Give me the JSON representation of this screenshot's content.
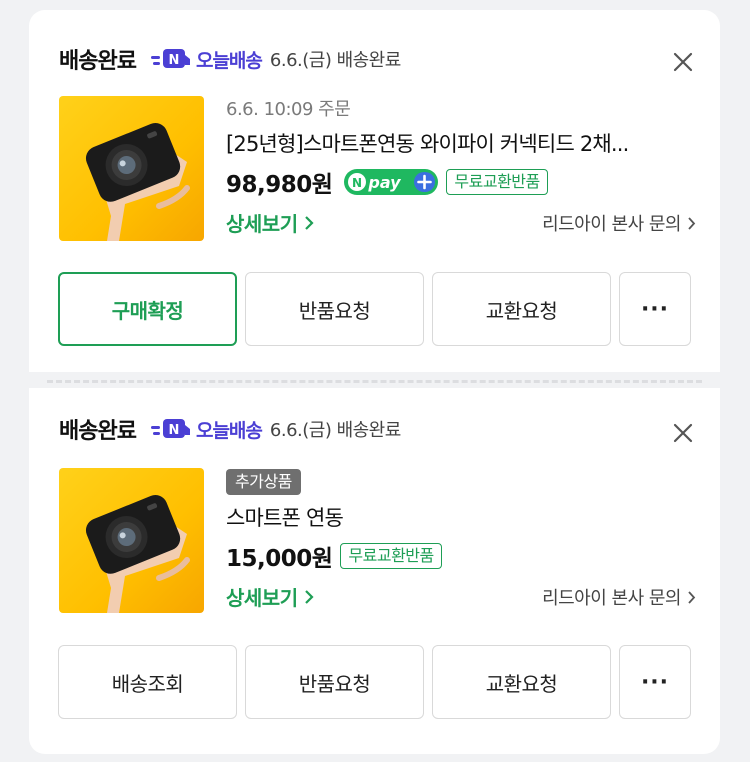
{
  "orders": [
    {
      "status_title": "배송완료",
      "today_label": "오늘배송",
      "date_status": "6.6.(금) 배송완료",
      "order_time": "6.6. 10:09 주문",
      "product_name": "[25년형]스마트폰연동 와이파이 커넥티드 2채...",
      "price": "98,980원",
      "npay_label": "pay",
      "free_tag": "무료교환반품",
      "detail_link": "상세보기",
      "inquiry_link": "리드아이 본사 문의",
      "buttons": [
        "구매확정",
        "반품요청",
        "교환요청"
      ],
      "more_label": "···"
    },
    {
      "status_title": "배송완료",
      "today_label": "오늘배송",
      "date_status": "6.6.(금) 배송완료",
      "extra_tag": "추가상품",
      "product_name": "스마트폰 연동",
      "price": "15,000원",
      "free_tag": "무료교환반품",
      "detail_link": "상세보기",
      "inquiry_link": "리드아이 본사 문의",
      "buttons": [
        "배송조회",
        "반품요청",
        "교환요청"
      ],
      "more_label": "···"
    }
  ],
  "colors": {
    "accent_green": "#1e9e55",
    "today_purple": "#4b3fd4",
    "background": "#f1f2f4"
  },
  "icons": [
    "close-icon",
    "chevron-right-icon",
    "delivery-truck-icon",
    "npay-plus-icon"
  ]
}
